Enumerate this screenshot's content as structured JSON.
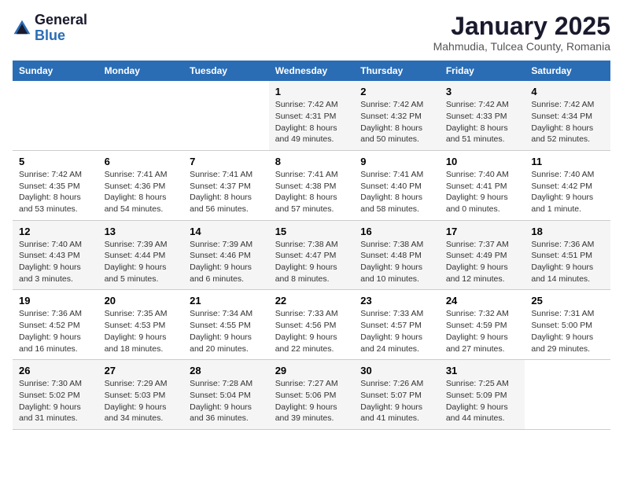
{
  "logo": {
    "text_general": "General",
    "text_blue": "Blue"
  },
  "title": "January 2025",
  "subtitle": "Mahmudia, Tulcea County, Romania",
  "days_of_week": [
    "Sunday",
    "Monday",
    "Tuesday",
    "Wednesday",
    "Thursday",
    "Friday",
    "Saturday"
  ],
  "weeks": [
    [
      {
        "day": "",
        "info": ""
      },
      {
        "day": "",
        "info": ""
      },
      {
        "day": "",
        "info": ""
      },
      {
        "day": "1",
        "info": "Sunrise: 7:42 AM\nSunset: 4:31 PM\nDaylight: 8 hours\nand 49 minutes."
      },
      {
        "day": "2",
        "info": "Sunrise: 7:42 AM\nSunset: 4:32 PM\nDaylight: 8 hours\nand 50 minutes."
      },
      {
        "day": "3",
        "info": "Sunrise: 7:42 AM\nSunset: 4:33 PM\nDaylight: 8 hours\nand 51 minutes."
      },
      {
        "day": "4",
        "info": "Sunrise: 7:42 AM\nSunset: 4:34 PM\nDaylight: 8 hours\nand 52 minutes."
      }
    ],
    [
      {
        "day": "5",
        "info": "Sunrise: 7:42 AM\nSunset: 4:35 PM\nDaylight: 8 hours\nand 53 minutes."
      },
      {
        "day": "6",
        "info": "Sunrise: 7:41 AM\nSunset: 4:36 PM\nDaylight: 8 hours\nand 54 minutes."
      },
      {
        "day": "7",
        "info": "Sunrise: 7:41 AM\nSunset: 4:37 PM\nDaylight: 8 hours\nand 56 minutes."
      },
      {
        "day": "8",
        "info": "Sunrise: 7:41 AM\nSunset: 4:38 PM\nDaylight: 8 hours\nand 57 minutes."
      },
      {
        "day": "9",
        "info": "Sunrise: 7:41 AM\nSunset: 4:40 PM\nDaylight: 8 hours\nand 58 minutes."
      },
      {
        "day": "10",
        "info": "Sunrise: 7:40 AM\nSunset: 4:41 PM\nDaylight: 9 hours\nand 0 minutes."
      },
      {
        "day": "11",
        "info": "Sunrise: 7:40 AM\nSunset: 4:42 PM\nDaylight: 9 hours\nand 1 minute."
      }
    ],
    [
      {
        "day": "12",
        "info": "Sunrise: 7:40 AM\nSunset: 4:43 PM\nDaylight: 9 hours\nand 3 minutes."
      },
      {
        "day": "13",
        "info": "Sunrise: 7:39 AM\nSunset: 4:44 PM\nDaylight: 9 hours\nand 5 minutes."
      },
      {
        "day": "14",
        "info": "Sunrise: 7:39 AM\nSunset: 4:46 PM\nDaylight: 9 hours\nand 6 minutes."
      },
      {
        "day": "15",
        "info": "Sunrise: 7:38 AM\nSunset: 4:47 PM\nDaylight: 9 hours\nand 8 minutes."
      },
      {
        "day": "16",
        "info": "Sunrise: 7:38 AM\nSunset: 4:48 PM\nDaylight: 9 hours\nand 10 minutes."
      },
      {
        "day": "17",
        "info": "Sunrise: 7:37 AM\nSunset: 4:49 PM\nDaylight: 9 hours\nand 12 minutes."
      },
      {
        "day": "18",
        "info": "Sunrise: 7:36 AM\nSunset: 4:51 PM\nDaylight: 9 hours\nand 14 minutes."
      }
    ],
    [
      {
        "day": "19",
        "info": "Sunrise: 7:36 AM\nSunset: 4:52 PM\nDaylight: 9 hours\nand 16 minutes."
      },
      {
        "day": "20",
        "info": "Sunrise: 7:35 AM\nSunset: 4:53 PM\nDaylight: 9 hours\nand 18 minutes."
      },
      {
        "day": "21",
        "info": "Sunrise: 7:34 AM\nSunset: 4:55 PM\nDaylight: 9 hours\nand 20 minutes."
      },
      {
        "day": "22",
        "info": "Sunrise: 7:33 AM\nSunset: 4:56 PM\nDaylight: 9 hours\nand 22 minutes."
      },
      {
        "day": "23",
        "info": "Sunrise: 7:33 AM\nSunset: 4:57 PM\nDaylight: 9 hours\nand 24 minutes."
      },
      {
        "day": "24",
        "info": "Sunrise: 7:32 AM\nSunset: 4:59 PM\nDaylight: 9 hours\nand 27 minutes."
      },
      {
        "day": "25",
        "info": "Sunrise: 7:31 AM\nSunset: 5:00 PM\nDaylight: 9 hours\nand 29 minutes."
      }
    ],
    [
      {
        "day": "26",
        "info": "Sunrise: 7:30 AM\nSunset: 5:02 PM\nDaylight: 9 hours\nand 31 minutes."
      },
      {
        "day": "27",
        "info": "Sunrise: 7:29 AM\nSunset: 5:03 PM\nDaylight: 9 hours\nand 34 minutes."
      },
      {
        "day": "28",
        "info": "Sunrise: 7:28 AM\nSunset: 5:04 PM\nDaylight: 9 hours\nand 36 minutes."
      },
      {
        "day": "29",
        "info": "Sunrise: 7:27 AM\nSunset: 5:06 PM\nDaylight: 9 hours\nand 39 minutes."
      },
      {
        "day": "30",
        "info": "Sunrise: 7:26 AM\nSunset: 5:07 PM\nDaylight: 9 hours\nand 41 minutes."
      },
      {
        "day": "31",
        "info": "Sunrise: 7:25 AM\nSunset: 5:09 PM\nDaylight: 9 hours\nand 44 minutes."
      },
      {
        "day": "",
        "info": ""
      }
    ]
  ]
}
